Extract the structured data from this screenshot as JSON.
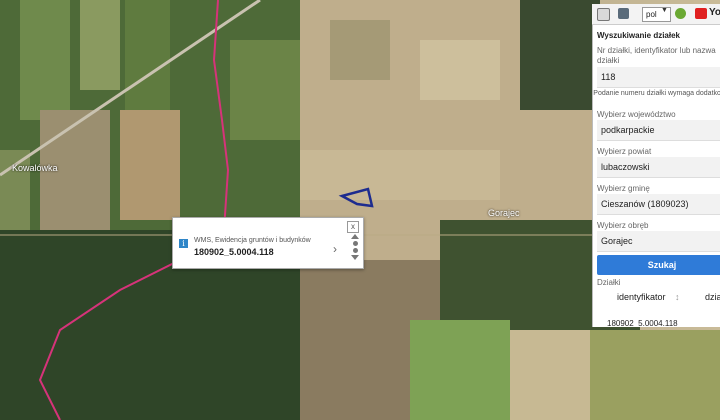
{
  "map": {
    "place_labels": [
      "Kowalówka",
      "Gorajec"
    ]
  },
  "popup": {
    "close_glyph": "x",
    "info_glyph": "i",
    "layer_name": "WMS, Ewidencja gruntów i budynków",
    "value": "180902_5.0004.118",
    "arrow_glyph": "›"
  },
  "toolbar": {
    "language": "pol",
    "icons": [
      "map-icon",
      "print-icon",
      "globe-icon",
      "youtube-icon"
    ],
    "partial_text": "Yo"
  },
  "panel": {
    "title": "Wyszukiwanie działek",
    "parcel_label": "Nr działki, identyfikator lub nazwa działki",
    "parcel_value": "118",
    "note": "Podanie numeru działki wymaga dodatkowych p",
    "voivodeship_label": "Wybierz województwo",
    "voivodeship_value": "podkarpackie",
    "county_label": "Wybierz powiat",
    "county_value": "lubaczowski",
    "commune_label": "Wybierz gminę",
    "commune_value": "Cieszanów (1809023)",
    "precinct_label": "Wybierz obręb",
    "precinct_value": "Gorajec",
    "search_button": "Szukaj",
    "results_label": "Działki",
    "columns": [
      "identyfikator",
      "dzia"
    ],
    "rows": [
      [
        "180902_5.0004.118",
        ""
      ]
    ]
  },
  "colors": {
    "boundary": "#d6337a",
    "parcel_outline": "#1d2c8f",
    "search_button": "#2f7bd8"
  }
}
